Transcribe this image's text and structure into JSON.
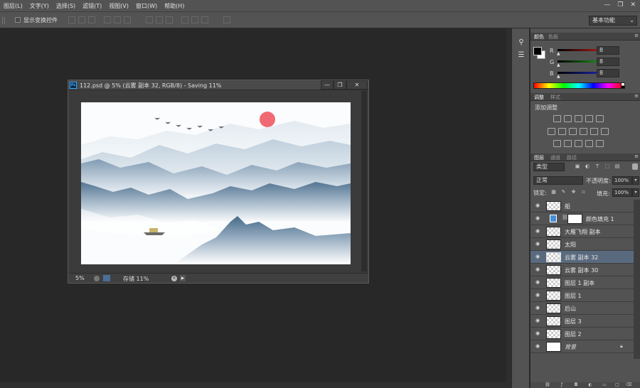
{
  "menu": [
    "图层(L)",
    "文字(Y)",
    "选择(S)",
    "滤镜(T)",
    "视图(V)",
    "窗口(W)",
    "帮助(H)"
  ],
  "window_controls": [
    "—",
    "❐",
    "✕"
  ],
  "options_bar": {
    "show_transform_label": "显示变换控件",
    "workspace": "基本功能"
  },
  "document": {
    "title": "112.psd @ 5% (云雾 副本 32, RGB/8) - Saving 11%",
    "ps_badge": "Ps",
    "zoom": "5%",
    "status": "存储 11%",
    "buttons": [
      "—",
      "❐",
      "✕"
    ]
  },
  "color_panel": {
    "tabs": [
      "颜色",
      "色板"
    ],
    "channels": [
      {
        "label": "R",
        "value": "8",
        "color": "#e02020"
      },
      {
        "label": "G",
        "value": "8",
        "color": "#20c020"
      },
      {
        "label": "B",
        "value": "8",
        "color": "#2030e0"
      }
    ]
  },
  "adjustments_panel": {
    "tabs": [
      "调整",
      "样式"
    ],
    "title": "添加调整"
  },
  "layers_panel": {
    "tabs": [
      "图层",
      "通道",
      "路径"
    ],
    "filter_kind": "类型",
    "blend_mode": "正常",
    "opacity_label": "不透明度:",
    "opacity_value": "100%",
    "lock_label": "锁定:",
    "fill_label": "填充:",
    "fill_value": "100%",
    "layers": [
      {
        "name": "船",
        "selected": false
      },
      {
        "name": "颜色填充 1",
        "selected": false,
        "fill_layer": true,
        "fill_color": "#4a8fd6"
      },
      {
        "name": "大雁飞翔 副本",
        "selected": false
      },
      {
        "name": "太阳",
        "selected": false
      },
      {
        "name": "云雾 副本 32",
        "selected": true
      },
      {
        "name": "云雾 副本 30",
        "selected": false
      },
      {
        "name": "图层 1 副本",
        "selected": false
      },
      {
        "name": "图层 1",
        "selected": false
      },
      {
        "name": "后山",
        "selected": false
      },
      {
        "name": "图层 3",
        "selected": false
      },
      {
        "name": "图层 2",
        "selected": false
      },
      {
        "name": "背景",
        "selected": false,
        "locked": true,
        "italic": true
      }
    ]
  },
  "colors": {
    "ui_dark": "#282828",
    "ui_panel": "#535353",
    "selected_layer": "#5a6a7e",
    "mountain": "#4f7393",
    "sun": "#e84a55"
  }
}
